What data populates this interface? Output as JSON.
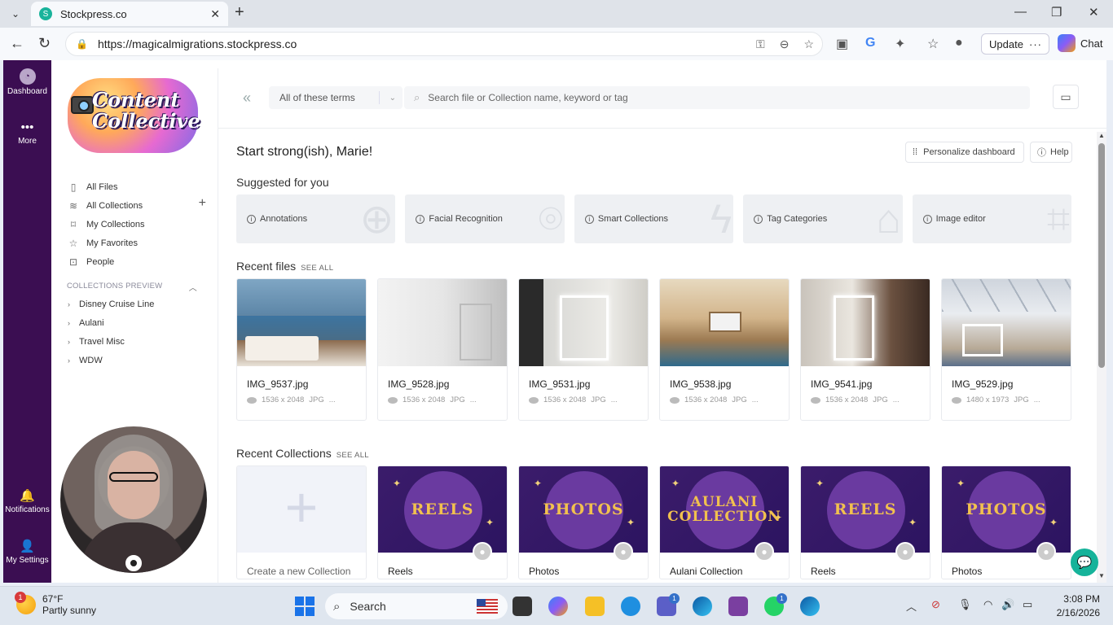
{
  "browser": {
    "tab_title": "Stockpress.co",
    "url": "https://magicalmigrations.stockpress.co",
    "update_label": "Update",
    "chat_label": "Chat"
  },
  "rail": {
    "dashboard": "Dashboard",
    "more": "More",
    "notifications": "Notifications",
    "settings": "My Settings"
  },
  "sidebar": {
    "logo_text_1": "Content",
    "logo_text_2": "Collective",
    "nav": [
      "All Files",
      "All Collections",
      "My Collections",
      "My Favorites",
      "People"
    ],
    "collections_header": "COLLECTIONS PREVIEW",
    "collections": [
      "Disney Cruise Line",
      "Aulani",
      "Travel Misc",
      "WDW"
    ]
  },
  "topbar": {
    "terms": "All of these terms",
    "search_placeholder": "Search file or Collection name, keyword or tag"
  },
  "dashboard": {
    "greeting": "Start strong(ish), Marie!",
    "personalize": "Personalize dashboard",
    "help": "Help",
    "suggested_title": "Suggested for you",
    "suggestions": [
      "Annotations",
      "Facial Recognition",
      "Smart Collections",
      "Tag Categories",
      "Image editor"
    ],
    "recent_files_title": "Recent files",
    "see_all": "SEE ALL",
    "files": [
      {
        "name": "IMG_9537.jpg",
        "dims": "1536 x 2048",
        "type": "JPG",
        "more": "..."
      },
      {
        "name": "IMG_9528.jpg",
        "dims": "1536 x 2048",
        "type": "JPG",
        "more": "..."
      },
      {
        "name": "IMG_9531.jpg",
        "dims": "1536 x 2048",
        "type": "JPG",
        "more": "..."
      },
      {
        "name": "IMG_9538.jpg",
        "dims": "1536 x 2048",
        "type": "JPG",
        "more": "..."
      },
      {
        "name": "IMG_9541.jpg",
        "dims": "1536 x 2048",
        "type": "JPG",
        "more": "..."
      },
      {
        "name": "IMG_9529.jpg",
        "dims": "1480 x 1973",
        "type": "JPG",
        "more": "..."
      }
    ],
    "recent_collections_title": "Recent Collections",
    "new_collection": "Create a new Collection",
    "collections": [
      {
        "thumb_line1": "REELS",
        "thumb_line2": "",
        "name": "Reels"
      },
      {
        "thumb_line1": "PHOTOS",
        "thumb_line2": "",
        "name": "Photos"
      },
      {
        "thumb_line1": "AULANI",
        "thumb_line2": "COLLECTION",
        "name": "Aulani Collection"
      },
      {
        "thumb_line1": "REELS",
        "thumb_line2": "",
        "name": "Reels"
      },
      {
        "thumb_line1": "PHOTOS",
        "thumb_line2": "",
        "name": "Photos"
      }
    ]
  },
  "taskbar": {
    "temp": "67°F",
    "weather": "Partly sunny",
    "weather_badge": "1",
    "search": "Search",
    "time": "3:08 PM",
    "date": "2/16/2026",
    "teams_badge": "1",
    "whatsapp_badge": "1"
  },
  "colors": {
    "rail": "#3b0e52",
    "accent": "#16b39a",
    "collection_gold": "#f2c14e"
  }
}
